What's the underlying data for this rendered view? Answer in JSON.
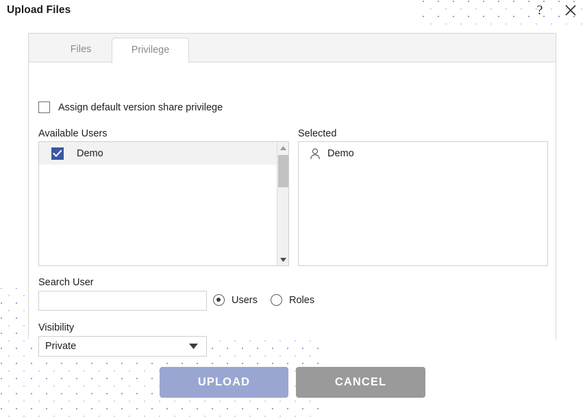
{
  "dialog": {
    "title": "Upload Files",
    "help_icon": "question-mark-icon",
    "close_icon": "close-icon"
  },
  "tabs": [
    {
      "id": "files",
      "label": "Files",
      "active": false
    },
    {
      "id": "privilege",
      "label": "Privilege",
      "active": true
    }
  ],
  "privilege": {
    "assign_default": {
      "label": "Assign default version share privilege",
      "checked": false
    },
    "available_users": {
      "label": "Available Users",
      "rows": [
        {
          "name": "Demo",
          "checked": true,
          "selected": true
        }
      ]
    },
    "selected": {
      "label": "Selected",
      "rows": [
        {
          "name": "Demo",
          "icon": "person-icon"
        }
      ]
    },
    "search_user": {
      "label": "Search User",
      "value": "",
      "placeholder": ""
    },
    "search_mode": {
      "options": [
        {
          "id": "users",
          "label": "Users",
          "checked": true
        },
        {
          "id": "roles",
          "label": "Roles",
          "checked": false
        }
      ]
    },
    "visibility": {
      "label": "Visibility",
      "value": "Private",
      "caret_icon": "chevron-down-icon"
    }
  },
  "actions": {
    "upload_label": "UPLOAD",
    "cancel_label": "CANCEL"
  },
  "colors": {
    "upload_button": "#9aa6d2",
    "cancel_button": "#9a9a9a",
    "checkbox_checked": "#3a57a5",
    "row_selected": "#f2f2f2",
    "tab_strip": "#f4f4f4",
    "dot_pattern": "#97a3d6"
  }
}
